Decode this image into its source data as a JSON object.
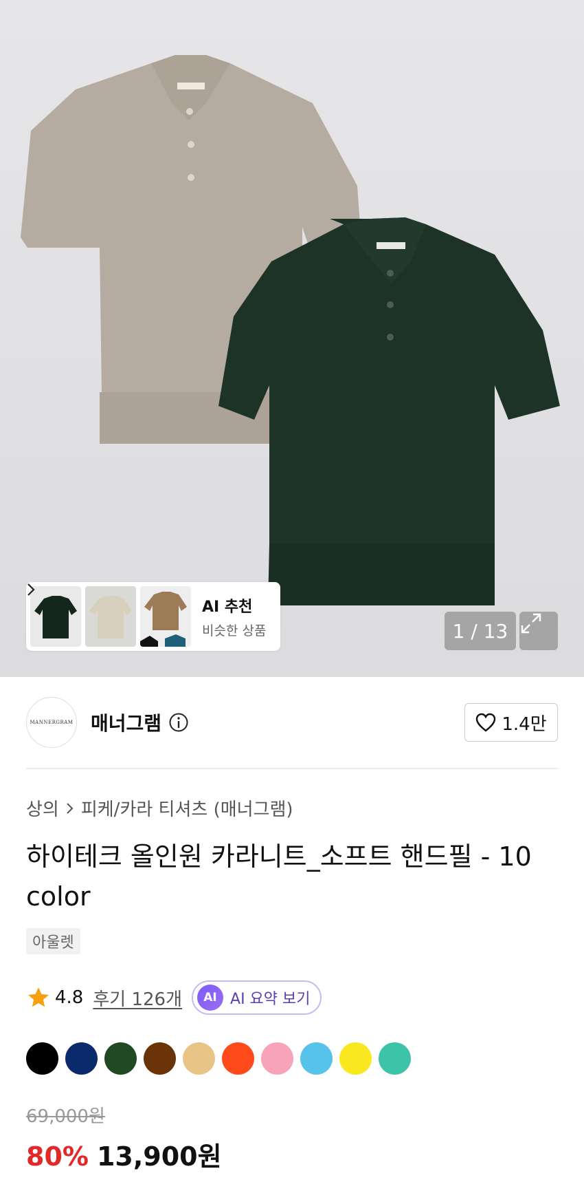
{
  "gallery": {
    "counter": "1 / 13",
    "ai_recommend": {
      "title": "AI 추천",
      "subtitle": "비슷한 상품"
    }
  },
  "brand": {
    "name": "매너그램",
    "logo_text": "MANNERGRAM",
    "like_count": "1.4만"
  },
  "breadcrumb": {
    "category": "상의",
    "subcategory": "피케/카라 티셔츠 (매너그램)"
  },
  "product": {
    "title": "하이테크 올인원 카라니트_소프트 핸드필 - 10 color",
    "tag": "아울렛",
    "rating": "4.8",
    "review_link": "후기 126개",
    "ai_summary_badge": "AI",
    "ai_summary_label": "AI 요약 보기",
    "original_price": "69,000원",
    "discount": "80%",
    "sale_price": "13,900원"
  },
  "colors": [
    "#000000",
    "#0b2a6b",
    "#1f4a24",
    "#6b3408",
    "#e8c586",
    "#ff4a1c",
    "#f9a3b8",
    "#58c3ea",
    "#f9e820",
    "#3dc3a8"
  ]
}
